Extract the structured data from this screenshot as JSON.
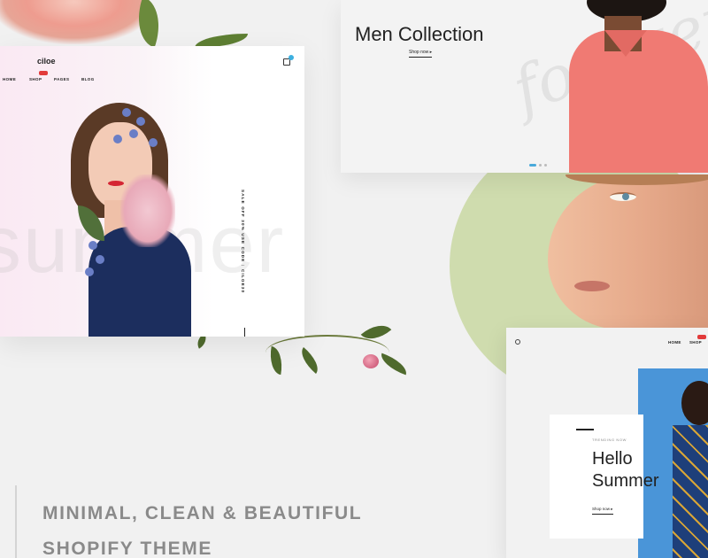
{
  "home_card": {
    "logo": "ciloe",
    "nav": [
      "HOME",
      "SHOP",
      "PAGES",
      "BLOG"
    ],
    "hot_badge": "",
    "background_word": "summer",
    "vertical_text": "SALE OFF 30% USE CODE : CILOE30"
  },
  "men_card": {
    "title": "Men Collection",
    "shop_link": "Shop now ▸",
    "script_word": "forever",
    "dots": 3
  },
  "summer_card": {
    "nav": [
      "HOME",
      "SHOP"
    ],
    "trending": "TRENDING NOW",
    "headline_line1": "Hello",
    "headline_line2": "Summer",
    "shop_link": "Shop now ▸"
  },
  "footer": {
    "line1": "MINIMAL, CLEAN & BEAUTIFUL",
    "line2": "SHOPIFY THEME"
  },
  "colors": {
    "background": "#f1f1f1",
    "accent_green": "#cfdcae",
    "accent_blue": "#4a95d8",
    "badge_red": "#e23b3b",
    "headline_gray": "#8a8a8a"
  }
}
